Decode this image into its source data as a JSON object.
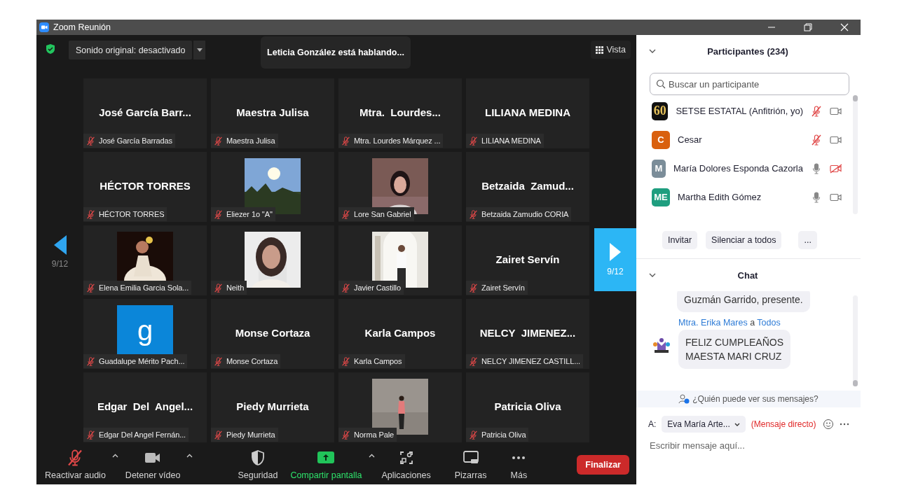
{
  "window": {
    "title": "Zoom Reunión"
  },
  "meeting": {
    "original_sound": "Sonido original: desactivado",
    "speaking": "Leticia González está hablando...",
    "view": "Vista",
    "page_prev": "9/12",
    "page_next": "9/12"
  },
  "tiles": [
    {
      "kind": "name",
      "name": "José García Barr...",
      "label": "José García Barradas",
      "muted": true
    },
    {
      "kind": "name",
      "name": "Maestra Julisa",
      "label": "Maestra Julisa",
      "muted": true
    },
    {
      "kind": "name",
      "name": "Mtra.  Lourdes...",
      "label": "Mtra. Lourdes Márquez ...",
      "muted": true
    },
    {
      "kind": "name",
      "name": "LILIANA MEDINA",
      "label": "LILIANA MEDINA",
      "muted": true
    },
    {
      "kind": "name",
      "name": "HÉCTOR TORRES",
      "label": "HÉCTOR TORRES",
      "muted": true
    },
    {
      "kind": "picture",
      "label": "Eliezer 1o \"A\"",
      "muted": true
    },
    {
      "kind": "picture",
      "label": "Lore San Gabriel",
      "muted": true
    },
    {
      "kind": "name",
      "name": "Betzaida  Zamud...",
      "label": "Betzaida Zamudio CORIA",
      "muted": true
    },
    {
      "kind": "picture",
      "label": "Elena Emilia Garcia Sola...",
      "muted": true
    },
    {
      "kind": "picture",
      "label": "Neith",
      "muted": true
    },
    {
      "kind": "picture",
      "label": "Javier Castillo",
      "muted": true
    },
    {
      "kind": "name",
      "name": "Zairet Servín",
      "label": "Zairet Servín",
      "muted": true
    },
    {
      "kind": "letter",
      "name": "g",
      "label": "Guadalupe Mérito Pach...",
      "muted": true
    },
    {
      "kind": "name",
      "name": "Monse Cortaza",
      "label": "Monse Cortaza",
      "muted": true
    },
    {
      "kind": "name",
      "name": "Karla Campos",
      "label": "Karla Campos",
      "muted": true
    },
    {
      "kind": "name",
      "name": "NELCY  JIMENEZ...",
      "label": "NELCY JIMENEZ CASTILL...",
      "muted": true
    },
    {
      "kind": "name",
      "name": "Edgar  Del  Angel...",
      "label": "Edgar Del Angel Fernán...",
      "muted": true
    },
    {
      "kind": "name",
      "name": "Piedy Murrieta",
      "label": "Piedy Murrieta",
      "muted": true
    },
    {
      "kind": "picture",
      "label": "Norma Pale",
      "muted": true
    },
    {
      "kind": "name",
      "name": "Patricia Oliva",
      "label": "Patricia Oliva",
      "muted": true
    }
  ],
  "toolbar": [
    {
      "kind": "mic",
      "label": "Reactivar audio",
      "muted": true,
      "caret": true
    },
    {
      "kind": "video",
      "label": "Detener vídeo",
      "muted": false,
      "caret": true
    },
    {
      "kind": "shield",
      "label": "Seguridad",
      "caret": false
    },
    {
      "kind": "share",
      "label": "Compartir pantalla",
      "caret": true
    },
    {
      "kind": "apps",
      "label": "Aplicaciones",
      "caret": false
    },
    {
      "kind": "board",
      "label": "Pizarras",
      "caret": false
    },
    {
      "kind": "more",
      "label": "Más",
      "caret": false
    }
  ],
  "end_button": "Finalizar",
  "participants": {
    "title": "Participantes (234)",
    "search_placeholder": "Buscar un participante",
    "items": [
      {
        "kind": "logo",
        "avatar": "60",
        "name": "SETSE ESTATAL (Anfitrión, yo)",
        "color": "#111111",
        "mic_muted": true,
        "video_off": false
      },
      {
        "kind": "initials",
        "avatar": "C",
        "name": "Cesar",
        "color": "#d9600e",
        "mic_muted": true,
        "video_off": false
      },
      {
        "kind": "initials",
        "avatar": "M",
        "name": "María Dolores Esponda Cazorla",
        "color": "#7b8d99",
        "mic_muted": false,
        "video_off": true
      },
      {
        "kind": "initials",
        "avatar": "ME",
        "name": "Martha Edith Gómez",
        "color": "#1f9e7f",
        "mic_muted": false,
        "video_off": false
      }
    ],
    "buttons": [
      "Invitar",
      "Silenciar a todos",
      "..."
    ]
  },
  "chat": {
    "title": "Chat",
    "messages": [
      {
        "kind": "continued",
        "text": "Guzmán  Garrido, presente."
      },
      {
        "kind": "full",
        "sender": "Mtra. Erika Mares",
        "connector": "a",
        "recipient": "Todos",
        "text": "FELIZ CUMPLEAÑOS\nMAESTA MARI CRUZ"
      }
    ],
    "notice": "¿Quién puede ver sus mensajes?",
    "to_label": "A:",
    "recipient": "Eva María Arte...",
    "mode": "(Mensaje directo)",
    "placeholder": "Escribir mensaje aquí..."
  }
}
